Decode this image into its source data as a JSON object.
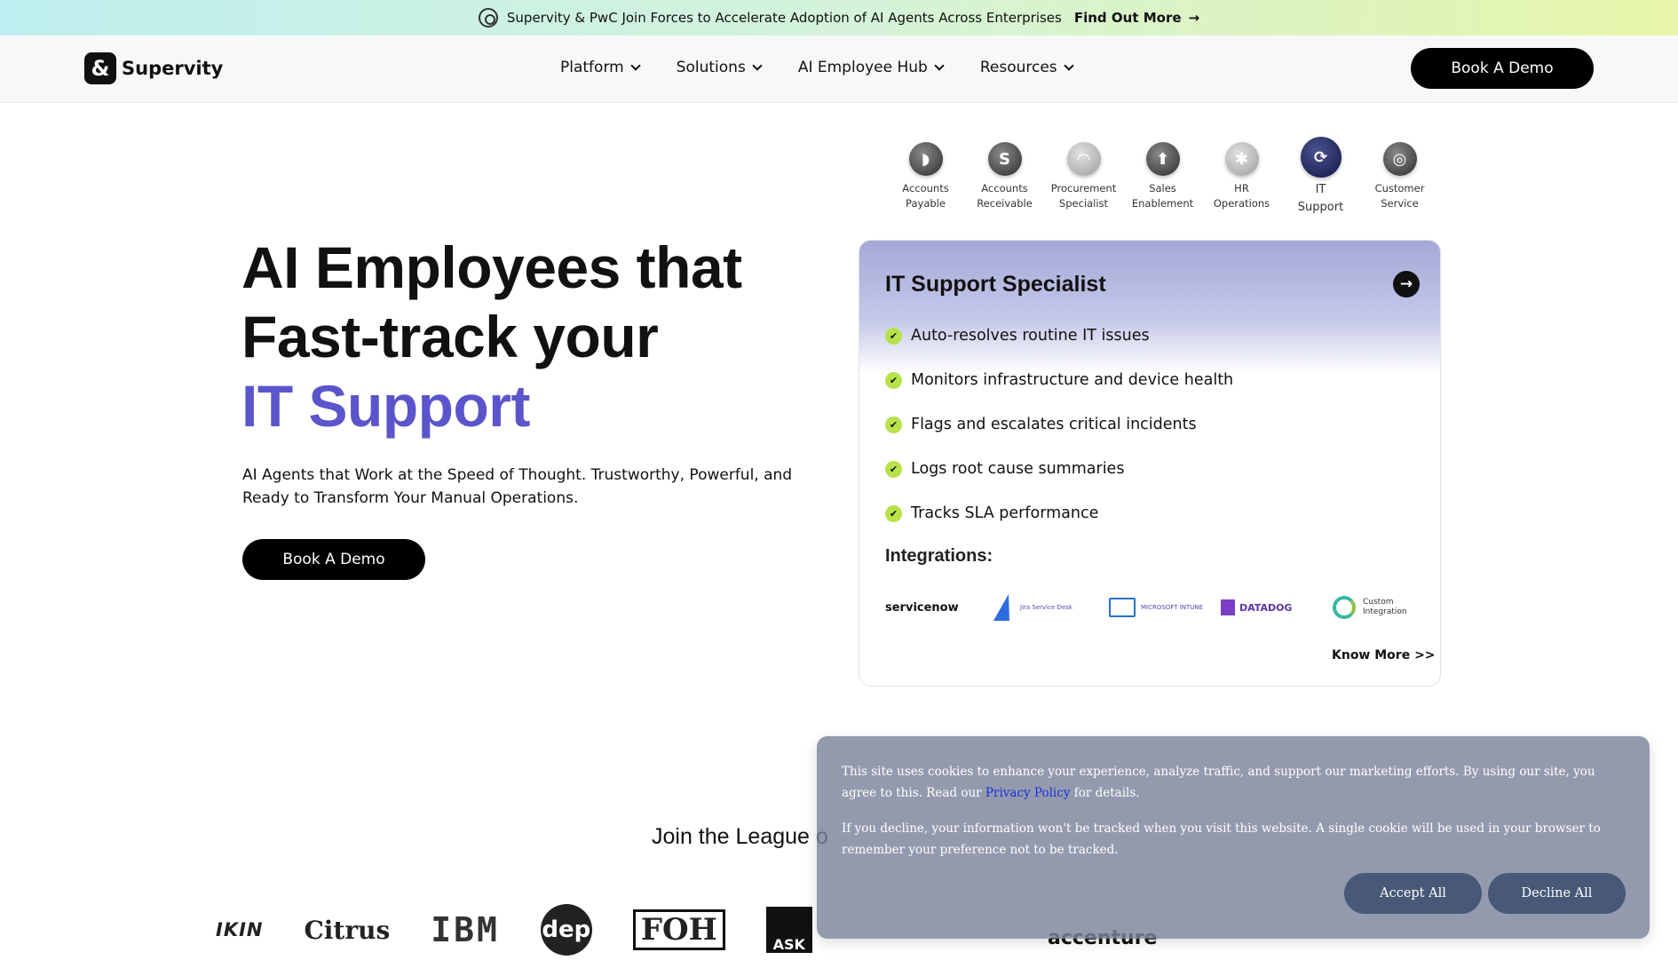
{
  "announcement": {
    "text": "Supervity & PwC Join Forces to Accelerate Adoption of AI Agents Across Enterprises",
    "link": "Find Out More",
    "arrow": "→"
  },
  "nav": {
    "logo_mark": "&",
    "logo_text": "Supervity",
    "menu": [
      "Platform",
      "Solutions",
      "AI Employee Hub",
      "Resources"
    ],
    "cta": "Book A Demo"
  },
  "hero": {
    "title_line1": "AI Employees that",
    "title_line2": "Fast-track your",
    "title_highlight": "IT Support",
    "subtitle": "AI Agents that Work at the Speed of Thought. Trustworthy, Powerful, and Ready to Transform Your Manual Operations.",
    "cta": "Book A Demo",
    "highlight_color": "#5b55cc"
  },
  "tabs": [
    {
      "line1": "Accounts",
      "line2": "Payable",
      "glyph": "◗"
    },
    {
      "line1": "Accounts",
      "line2": "Receivable",
      "glyph": "S"
    },
    {
      "line1": "Procurement",
      "line2": "Specialist",
      "glyph": "◠"
    },
    {
      "line1": "Sales",
      "line2": "Enablement",
      "glyph": "⬆"
    },
    {
      "line1": "HR",
      "line2": "Operations",
      "glyph": "✱"
    },
    {
      "line1": "IT",
      "line2": "Support",
      "glyph": "⟳"
    },
    {
      "line1": "Customer",
      "line2": "Service",
      "glyph": "◎"
    }
  ],
  "card": {
    "title": "IT Support Specialist",
    "arrow": "→",
    "features": [
      "Auto-resolves routine IT issues",
      "Monitors infrastructure and device health",
      "Flags and escalates critical incidents",
      "Logs root cause summaries",
      "Tracks SLA performance"
    ],
    "check": "✔",
    "integrations_title": "Integrations:",
    "integrations": {
      "servicenow": "servicenow",
      "jira": "Jira Service Desk",
      "intune": "MICROSOFT INTUNE",
      "datadog": "DATADOG",
      "custom_line1": "Custom",
      "custom_line2": "Integration"
    },
    "know_more": "Know More >>"
  },
  "league": {
    "title": "Join the League o",
    "logos": {
      "ikin": "IKIN",
      "citrus": "Citrus",
      "ibm": "IBM",
      "dep": "dep",
      "foh": "FOH",
      "ask": "ASK",
      "accenture": "accenture"
    }
  },
  "cookie": {
    "text1": "This site uses cookies to enhance your experience, analyze traffic, and support our marketing efforts. By using our site, you agree to this. Read our",
    "privacy_link": "Privacy Policy",
    "text1_end": "for details.",
    "text2": "If you decline, your information won't be tracked when you visit this website. A single cookie will be used in your browser to remember your preference not to be tracked.",
    "accept": "Accept All",
    "decline": "Decline All"
  }
}
